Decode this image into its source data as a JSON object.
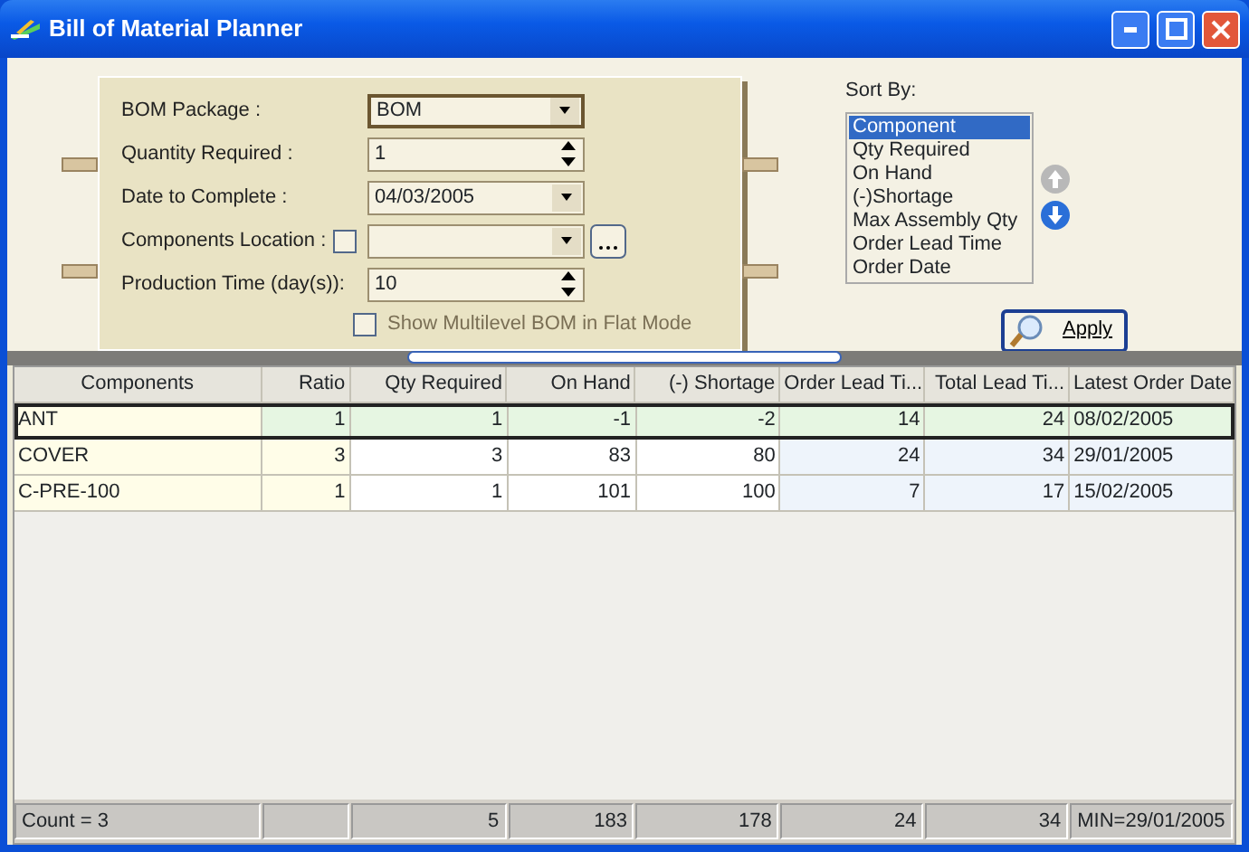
{
  "window": {
    "title": "Bill of Material Planner"
  },
  "form": {
    "fields": [
      {
        "label": "BOM Package :",
        "kind": "combo",
        "value": "BOM",
        "focused": true
      },
      {
        "label": "Quantity Required :",
        "kind": "spin",
        "value": "1",
        "focused": false
      },
      {
        "label": "Date to Complete :",
        "kind": "combo",
        "value": "04/03/2005",
        "focused": false
      },
      {
        "label": "Components Location :",
        "kind": "combo-check",
        "checked": false,
        "focused": false
      },
      {
        "label": "Production Time (day(s)):",
        "kind": "spin",
        "value": "10",
        "focused": false
      }
    ],
    "flat_mode": {
      "label": "Show Multilevel BOM in Flat Mode",
      "checked": false
    }
  },
  "sort": {
    "label": "Sort By:",
    "items": [
      {
        "label": "Component",
        "selected": true
      },
      {
        "label": "Qty Required",
        "selected": false
      },
      {
        "label": "On Hand",
        "selected": false
      },
      {
        "label": "(-)Shortage",
        "selected": false
      },
      {
        "label": "Max Assembly Qty",
        "selected": false
      },
      {
        "label": "Order Lead Time",
        "selected": false
      },
      {
        "label": "Order Date",
        "selected": false
      }
    ]
  },
  "apply_button": {
    "label": "Apply"
  },
  "table": {
    "columns": [
      {
        "label": "Components"
      },
      {
        "label": "Ratio"
      },
      {
        "label": "Qty Required"
      },
      {
        "label": "On Hand"
      },
      {
        "label": "(-) Shortage"
      },
      {
        "label": "Order Lead Ti..."
      },
      {
        "label": "Total Lead Ti..."
      },
      {
        "label": "Latest Order Date"
      }
    ],
    "rows": [
      {
        "selected": true,
        "cells": [
          "ANT",
          "1",
          "1",
          "-1",
          "-2",
          "14",
          "24",
          "08/02/2005"
        ]
      },
      {
        "selected": false,
        "cells": [
          "COVER",
          "3",
          "3",
          "83",
          "80",
          "24",
          "34",
          "29/01/2005"
        ]
      },
      {
        "selected": false,
        "cells": [
          "C-PRE-100",
          "1",
          "1",
          "101",
          "100",
          "7",
          "17",
          "15/02/2005"
        ]
      }
    ],
    "footer": {
      "count": "Count = 3",
      "totals": [
        "5",
        "183",
        "178",
        "24",
        "34",
        "MIN=29/01/2005"
      ]
    }
  }
}
